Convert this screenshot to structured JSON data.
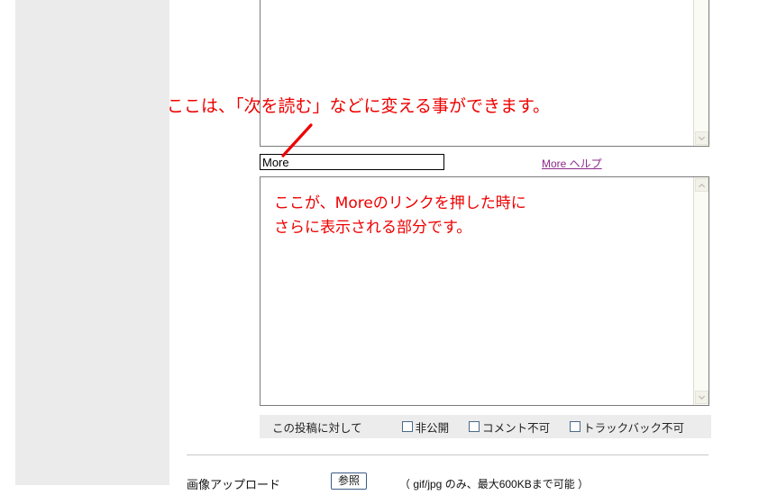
{
  "page": {
    "background_color": "#ffffff",
    "sidebar_color": "#ebebeb",
    "annotation_color": "#ee0000",
    "link_color": "#8b2a8b",
    "options_bar_color": "#ececec"
  },
  "body_field": {
    "name": "body-textarea",
    "value": "",
    "scrollbar": {
      "down_arrow": "chevron-down-icon"
    }
  },
  "more_field": {
    "label_input_value": "More",
    "placeholder": "",
    "help_link": "More ヘルプ"
  },
  "more_textarea": {
    "value": "",
    "scrollbar": {
      "up_arrow": "chevron-up-icon",
      "down_arrow": "chevron-down-icon"
    }
  },
  "options_bar": {
    "label": "この投稿に対して",
    "checkboxes": [
      {
        "label": "非公開",
        "checked": false
      },
      {
        "label": "コメント不可",
        "checked": false
      },
      {
        "label": "トラックバック不可",
        "checked": false
      }
    ]
  },
  "upload_row": {
    "label": "画像アップロード",
    "button_label": "参照",
    "note": "（ gif/jpg のみ、最大600KBまで可能 ）"
  },
  "annotations": {
    "title_prefix": "ここは、",
    "title_main": "「次を読む」などに変える事ができます。",
    "more_body_line1": "ここが、Moreのリンクを押した時に",
    "more_body_line2": "さらに表示される部分です。",
    "arrow": "red-arrow-pointer"
  }
}
